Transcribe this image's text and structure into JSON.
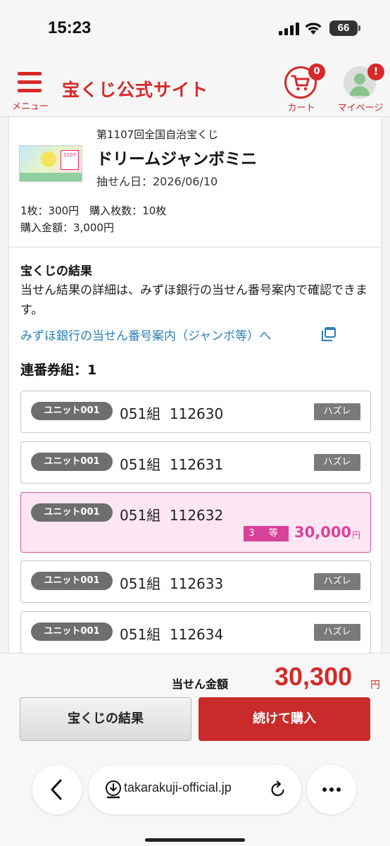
{
  "status_bar": {
    "time": "15:23",
    "battery": "66"
  },
  "header": {
    "menu_label": "メニュー",
    "logo": "宝くじ公式サイト",
    "cart_label": "カート",
    "cart_count": "0",
    "mypage_label": "マイページ",
    "mypage_badge": "!"
  },
  "lottery": {
    "round": "第1107回全国自治宝くじ",
    "name": "ドリームジャンボミニ",
    "draw_date": "抽せん日：2026/06/10",
    "price_info": "1枚：300円　購入枚数：10枚",
    "total_info": "購入金額：3,000円"
  },
  "results": {
    "heading": "宝くじの結果",
    "description": "当せん結果の詳細は、みずほ銀行の当せん番号案内で確認できます。",
    "link_text": "みずほ銀行の当せん番号案内（ジャンボ等）へ",
    "series_heading": "連番券組：1"
  },
  "tickets": [
    {
      "unit": "ユニット001",
      "number": "051組  112630",
      "status": "ハズレ"
    },
    {
      "unit": "ユニット001",
      "number": "051組  112631",
      "status": "ハズレ"
    },
    {
      "unit": "ユニット001",
      "number": "051組  112632",
      "rank": "3 等",
      "prize": "30,000",
      "yen": "円"
    },
    {
      "unit": "ユニット001",
      "number": "051組  112633",
      "status": "ハズレ"
    },
    {
      "unit": "ユニット001",
      "number": "051組  112634",
      "status": "ハズレ"
    }
  ],
  "footer": {
    "total_label": "当せん金額",
    "total_amount": "30,300",
    "total_yen": "円",
    "results_button": "宝くじの結果",
    "buy_button": "続けて購入"
  },
  "browser": {
    "url": "takarakuji-official.jp"
  },
  "colors": {
    "brand_red": "#d8292a",
    "prize_pink": "#d9429a",
    "link_blue": "#2a7fb8"
  }
}
